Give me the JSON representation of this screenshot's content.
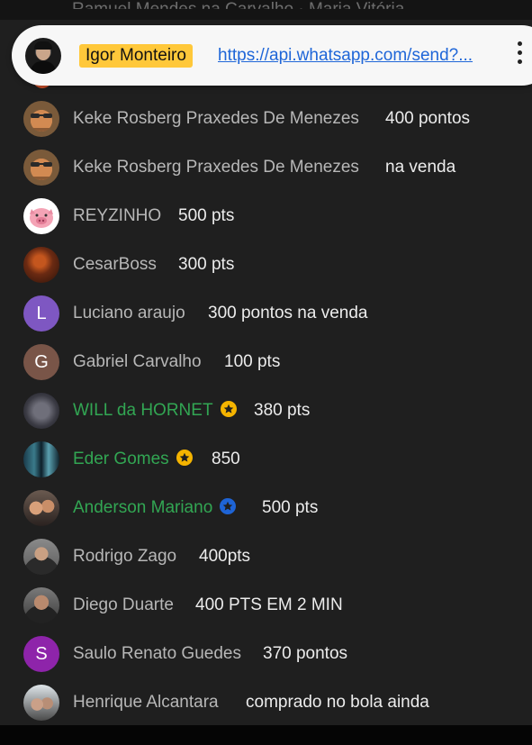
{
  "header": {
    "ghost_text": "Ramuel Mendes na Carvalho · Maria Vitória"
  },
  "sender": {
    "name": "Igor Monteiro",
    "link": "https://api.whatsapp.com/send?..."
  },
  "colors": {
    "background": "#1f1f1f",
    "name_chip": "#ffc83a",
    "link": "#1f66d8",
    "admin_name": "#32a653",
    "gold_star": "#f5b400",
    "blue_star": "#1e64d6"
  },
  "contacts": [
    {
      "name": "Keke Rosberg Praxedes De Menezes",
      "message": "400 pontos",
      "avatar": "photo"
    },
    {
      "name": "Keke Rosberg Praxedes De Menezes",
      "message": "na venda",
      "avatar": "photo"
    },
    {
      "name": "REYZINHO",
      "message": "500 pts",
      "avatar": "pig-icon"
    },
    {
      "name": "CesarBoss",
      "message": "300 pts",
      "avatar": "photo"
    },
    {
      "name": "Luciano araujo",
      "message": "300 pontos na venda",
      "avatar_letter": "L"
    },
    {
      "name": "Gabriel Carvalho",
      "message": "100 pts",
      "avatar_letter": "G"
    },
    {
      "name": "WILL da HORNET",
      "message": "380 pts",
      "avatar": "photo",
      "badge": "gold-star-icon"
    },
    {
      "name": "Eder Gomes",
      "message": "850",
      "avatar": "photo",
      "badge": "gold-star-icon"
    },
    {
      "name": "Anderson Mariano",
      "message": "500 pts",
      "avatar": "photo",
      "badge": "blue-star-icon"
    },
    {
      "name": "Rodrigo Zago",
      "message": "400pts",
      "avatar": "photo"
    },
    {
      "name": "Diego Duarte",
      "message": "400 PTS EM 2 MIN",
      "avatar": "photo"
    },
    {
      "name": "Saulo Renato Guedes",
      "message": "370 pontos",
      "avatar_letter": "S"
    },
    {
      "name": "Henrique Alcantara",
      "message": "comprado no bola ainda",
      "avatar": "photo"
    }
  ]
}
